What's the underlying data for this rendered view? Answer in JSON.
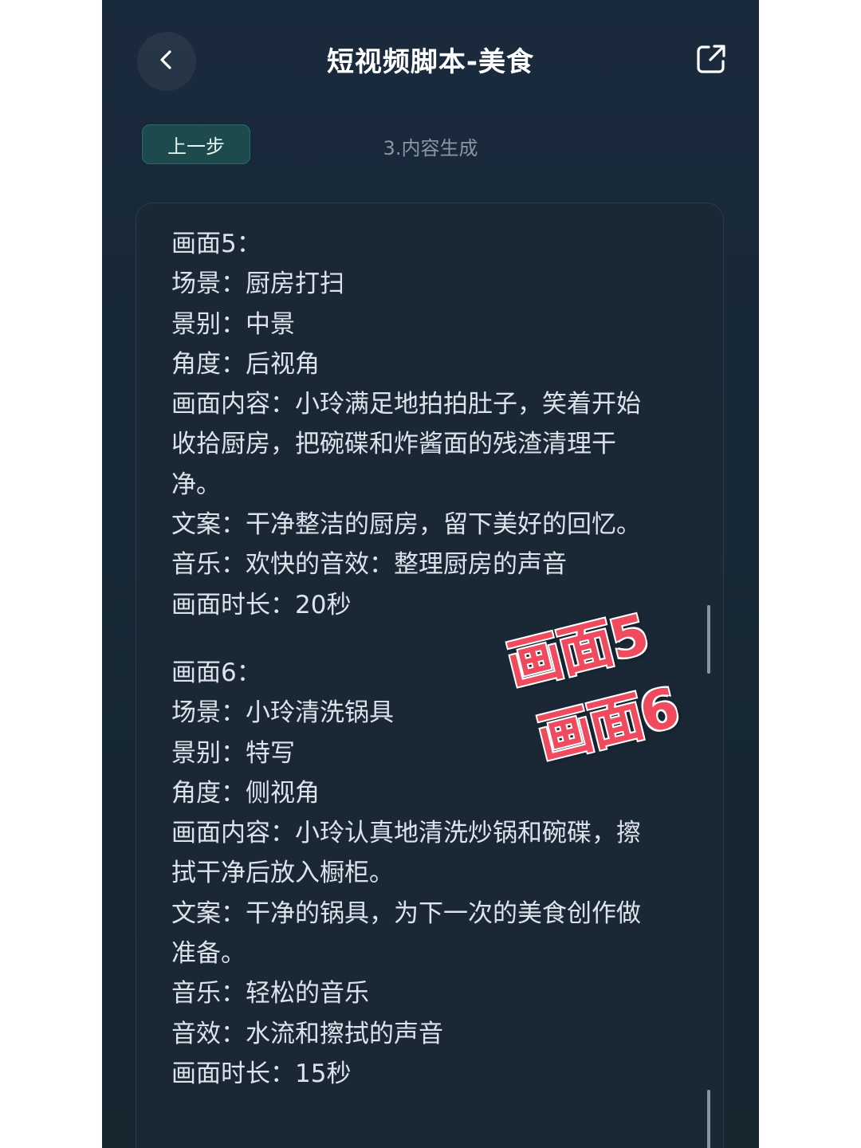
{
  "header": {
    "title": "短视频脚本-美食",
    "back_icon": "chevron-left-icon",
    "share_icon": "share-external-icon"
  },
  "toolbar": {
    "prev_label": "上一步",
    "step_label": "3.内容生成"
  },
  "content": {
    "scene5": [
      "画面5：",
      "场景：厨房打扫",
      "景别：中景",
      "角度：后视角",
      "画面内容：小玲满足地拍拍肚子，笑着开始",
      "收拾厨房，把碗碟和炸酱面的残渣清理干",
      "净。",
      "文案：干净整洁的厨房，留下美好的回忆。",
      "音乐：欢快的音效：整理厨房的声音",
      "画面时长：20秒"
    ],
    "scene6": [
      "画面6：",
      "场景：小玲清洗锅具",
      "景别：特写",
      "角度：侧视角",
      "画面内容：小玲认真地清洗炒锅和碗碟，擦",
      "拭干净后放入橱柜。",
      "文案：干净的锅具，为下一次的美食创作做",
      "准备。",
      "音乐：轻松的音乐",
      "音效：水流和擦拭的声音",
      "画面时长：15秒"
    ]
  },
  "stamps": {
    "first": "画面5",
    "second": "画面6",
    "color": "#ef4a5d"
  },
  "colors": {
    "background": "#172838",
    "accent_button": "#1d4a4c",
    "text": "#dde3ea"
  }
}
